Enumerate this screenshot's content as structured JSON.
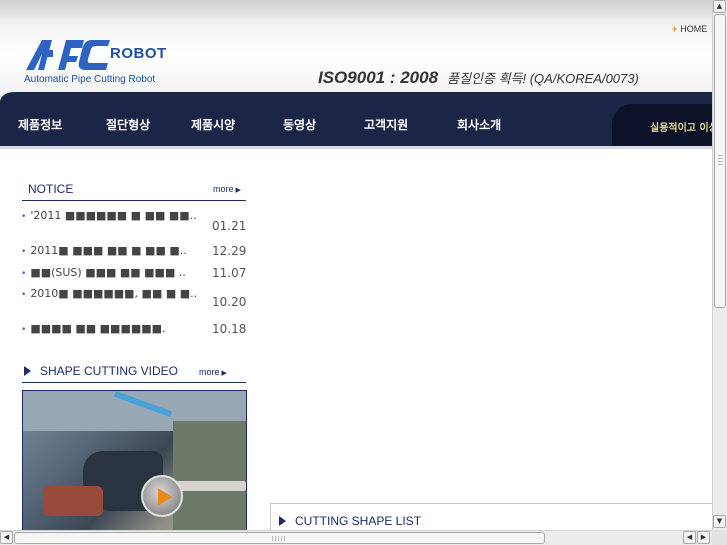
{
  "header": {
    "logo_letters": "APC",
    "logo_robot": "ROBOT",
    "logo_tagline": "Automatic Pipe Cutting Robot",
    "home_label": "HOME",
    "iso_main": "ISO9001 : 2008",
    "iso_sub": "품질인증 획득! (QA/KOREA/0073)"
  },
  "nav": {
    "items": [
      {
        "label": "제품정보"
      },
      {
        "label": "절단형상"
      },
      {
        "label": "제품시양"
      },
      {
        "label": "동영상"
      },
      {
        "label": "고객지원"
      },
      {
        "label": "회사소개"
      }
    ],
    "marquee": "실용적이고 이상"
  },
  "notice": {
    "title": "NOTICE",
    "more": "more",
    "items": [
      {
        "text": "'2011 ■■■■■■ ■ ■■ ■■..",
        "date": "01.21"
      },
      {
        "text": "2011■ ■■■ ■■ ■ ■■ ■..",
        "date": "12.29"
      },
      {
        "text": "■■(SUS) ■■■ ■■ ■■■ ..",
        "date": "11.07"
      },
      {
        "text": "2010■ ■■■■■■, ■■ ■ ■..",
        "date": "10.20"
      },
      {
        "text": "■■■■ ■■ ■■■■■■.",
        "date": "10.18"
      }
    ]
  },
  "video": {
    "title": "SHAPE CUTTING VIDEO",
    "more": "more"
  },
  "cutting_shape": {
    "title": "CUTTING  SHAPE  LIST"
  },
  "colors": {
    "nav_bg": "#1b2547",
    "accent_blue": "#1f4fa8",
    "title_navy": "#1b2c6b",
    "play_orange": "#e8891c"
  }
}
